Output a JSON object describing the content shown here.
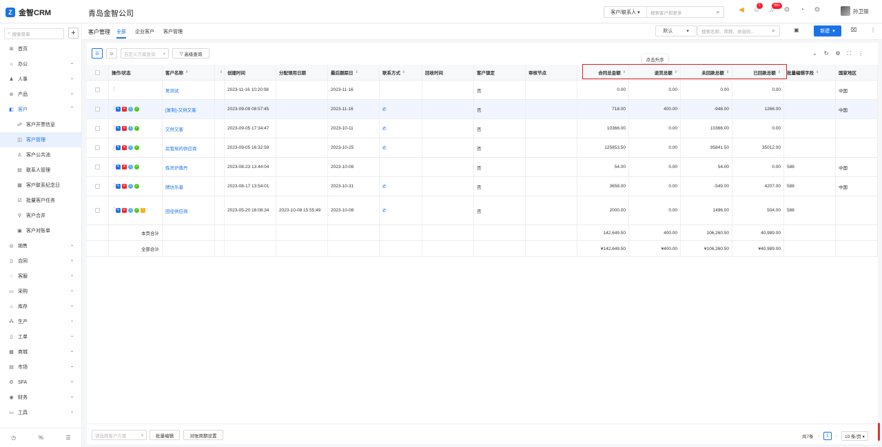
{
  "app": {
    "logo": "金智CRM",
    "logo_mark": "Z",
    "company": "青岛金智公司"
  },
  "top_search": {
    "scope": "客户/联系人",
    "placeholder": "搜索客户和更多"
  },
  "badges": {
    "contacts": "1",
    "notifications": "99+"
  },
  "user": {
    "name": "孙卫丽"
  },
  "sidebar": {
    "search_placeholder": "搜索菜单",
    "items": [
      {
        "label": "首页",
        "icon": "home-icon",
        "glyph": "⊞"
      },
      {
        "label": "办公",
        "icon": "office-icon",
        "glyph": "⌂",
        "chev": true
      },
      {
        "label": "人事",
        "icon": "people-icon",
        "glyph": "♟",
        "chev": true
      },
      {
        "label": "产品",
        "icon": "product-icon",
        "glyph": "⊛",
        "chev": true
      },
      {
        "label": "客户",
        "icon": "customer-icon",
        "glyph": "◧",
        "chev": true,
        "open": true
      },
      {
        "label": "客户开票信息",
        "icon": "invoice-icon",
        "glyph": "☍",
        "sub": true
      },
      {
        "label": "客户管理",
        "icon": "customer-manage-icon",
        "glyph": "◫",
        "sub": true,
        "active": true
      },
      {
        "label": "客户公共池",
        "icon": "pool-icon",
        "glyph": "♙",
        "sub": true
      },
      {
        "label": "联系人管理",
        "icon": "contact-icon",
        "glyph": "▤",
        "sub": true
      },
      {
        "label": "客户联系纪念日",
        "icon": "calendar-icon",
        "glyph": "▦",
        "sub": true
      },
      {
        "label": "批量客户任务",
        "icon": "task-icon",
        "glyph": "☑",
        "sub": true
      },
      {
        "label": "客户合并",
        "icon": "merge-icon",
        "glyph": "⚲",
        "sub": true
      },
      {
        "label": "客户对账单",
        "icon": "statement-icon",
        "glyph": "▣",
        "sub": true
      },
      {
        "label": "销售",
        "icon": "sales-icon",
        "glyph": "◎",
        "chev": true
      },
      {
        "label": "合同",
        "icon": "contract-icon",
        "glyph": "▯",
        "chev": true
      },
      {
        "label": "客服",
        "icon": "service-icon",
        "glyph": "◌",
        "chev": true
      },
      {
        "label": "采购",
        "icon": "purchase-icon",
        "glyph": "▭",
        "chev": true
      },
      {
        "label": "库存",
        "icon": "inventory-icon",
        "glyph": "⌂",
        "chev": true
      },
      {
        "label": "生产",
        "icon": "production-icon",
        "glyph": "⁂",
        "chev": true
      },
      {
        "label": "工单",
        "icon": "workorder-icon",
        "glyph": "▯",
        "chev": true
      },
      {
        "label": "商城",
        "icon": "mall-icon",
        "glyph": "▦",
        "chev": true
      },
      {
        "label": "市场",
        "icon": "market-icon",
        "glyph": "▤",
        "chev": true
      },
      {
        "label": "SFA",
        "icon": "sfa-icon",
        "glyph": "⚙",
        "chev": true
      },
      {
        "label": "财务",
        "icon": "finance-icon",
        "glyph": "◉",
        "chev": true
      },
      {
        "label": "工具",
        "icon": "tool-icon",
        "glyph": "▭",
        "chev": true
      }
    ]
  },
  "header": {
    "title": "客户管理",
    "tabs": [
      {
        "label": "全部",
        "active": true
      },
      {
        "label": "企业客户"
      },
      {
        "label": "客户管理"
      }
    ],
    "view_select": "默认",
    "search_placeholder": "搜索名称、简称、拼音码...",
    "new_button": "新建"
  },
  "toolbar": {
    "plan_placeholder": "自定义方案查询",
    "advanced": "高级查询"
  },
  "tooltip": "点击升序",
  "columns": {
    "ops": "操作/状态",
    "name": "客户名称",
    "created": "创建时间",
    "assigned": "分配领用日期",
    "last_follow": "最后跟踪日",
    "contact": "联系方式",
    "recovery": "回收时间",
    "locked": "客户锁定",
    "review": "审核节点",
    "contract_total": "合同总金额",
    "return_total": "退货总额",
    "unpaid_total": "未回款总额",
    "paid_total": "已回款总额",
    "batch_field": "批量编辑字段",
    "region": "国家地区"
  },
  "rows": [
    {
      "ops": [
        "dots"
      ],
      "name": "吴测试",
      "created": "2023-11-16 10:20:08",
      "assigned": "",
      "last_follow": "2023-11-16",
      "phone": false,
      "locked": "否",
      "contract_total": "0.00",
      "return_total": "0.00",
      "unpaid_total": "0.00",
      "paid_total": "0.00",
      "batch_field": "",
      "region": "中国"
    },
    {
      "ops": [
        "dots",
        "blue",
        "red",
        "cyan",
        "green"
      ],
      "name": "[复制]-又供又客",
      "created": "2023-09-09 08:57:45",
      "assigned": "",
      "last_follow": "2023-11-16",
      "phone": true,
      "locked": "否",
      "contract_total": "718.00",
      "return_total": "400.00",
      "unpaid_total": "-948.00",
      "paid_total": "1266.00",
      "batch_field": "",
      "region": "中国",
      "highlight": true
    },
    {
      "ops": [
        "dots",
        "blue",
        "red",
        "cyan",
        "green"
      ],
      "name": "又供又客",
      "created": "2023-09-05 17:34:47",
      "assigned": "",
      "last_follow": "2023-10-11",
      "phone": true,
      "locked": "否",
      "contract_total": "10366.00",
      "return_total": "0.00",
      "unpaid_total": "10366.00",
      "paid_total": "0.00",
      "batch_field": "",
      "region": ""
    },
    {
      "ops": [
        "dots",
        "blue",
        "red",
        "cyan",
        "green"
      ],
      "name": "房管局的供应商",
      "created": "2023-09-05 16:32:59",
      "assigned": "",
      "last_follow": "2023-10-25",
      "phone": true,
      "locked": "否",
      "contract_total": "125853.50",
      "return_total": "0.00",
      "unpaid_total": "95841.50",
      "paid_total": "35012.00",
      "batch_field": "",
      "region": ""
    },
    {
      "ops": [
        "dots",
        "blue",
        "red",
        "cyan",
        "green"
      ],
      "name": "炼灵炉典丹",
      "created": "2023-08-23 13:44:04",
      "assigned": "",
      "last_follow": "2023-10-08",
      "phone": false,
      "locked": "否",
      "contract_total": "54.00",
      "return_total": "0.00",
      "unpaid_total": "54.00",
      "paid_total": "0.00",
      "batch_field": "588",
      "region": "中国"
    },
    {
      "ops": [
        "dots",
        "blue",
        "red",
        "cyan",
        "green"
      ],
      "name": "牌坊乐基",
      "created": "2023-08-17 13:54:01",
      "assigned": "",
      "last_follow": "2023-10-31",
      "phone": true,
      "locked": "否",
      "contract_total": "3658.00",
      "return_total": "0.00",
      "unpaid_total": "-549.00",
      "paid_total": "4207.00",
      "batch_field": "588",
      "region": "中国"
    },
    {
      "ops": [
        "dots",
        "blue",
        "red",
        "cyan",
        "green",
        "orange"
      ],
      "name": "田径供应商",
      "created": "2023-05-20 16:08:34",
      "assigned": "2023-10-08 15:55:49",
      "last_follow": "2023-10-08",
      "phone": true,
      "locked": "否",
      "contract_total": "2000.00",
      "return_total": "0.00",
      "unpaid_total": "1496.00",
      "paid_total": "504.00",
      "batch_field": "588",
      "region": "",
      "tall": true
    }
  ],
  "totals": {
    "page": {
      "label": "本页合计",
      "contract_total": "142,649.50",
      "return_total": "400.00",
      "unpaid_total": "106,260.50",
      "paid_total": "40,989.00"
    },
    "all": {
      "label": "全部合计",
      "contract_total": "¥142,649.50",
      "return_total": "¥400.00",
      "unpaid_total": "¥106,260.50",
      "paid_total": "¥40,989.00"
    }
  },
  "footer": {
    "plan_placeholder": "请选择客户方案",
    "batch_edit": "批量编辑",
    "period_setting": "对账周期设置",
    "total": "共7条",
    "page": "1",
    "page_size": "10 条/页"
  },
  "colors": {
    "accent": "#1a73e8",
    "highlight_box": "#e02020"
  }
}
